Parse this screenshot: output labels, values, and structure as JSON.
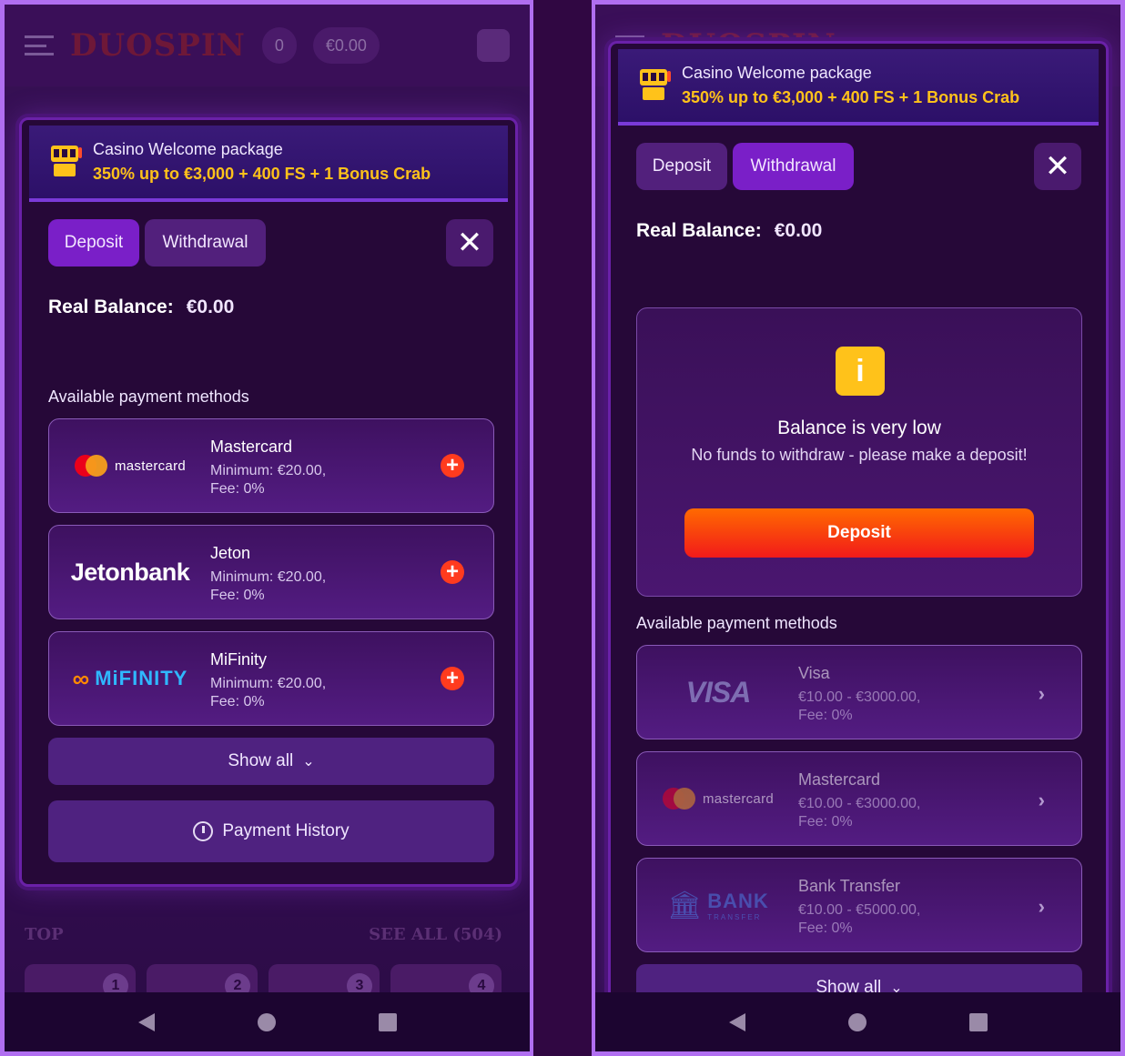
{
  "background_app": {
    "logo_text": "DUOSPIN",
    "coins": "0",
    "balance": "€0.00",
    "top_label": "TOP",
    "see_all": "SEE ALL (504)",
    "card_numbers": [
      "1",
      "2",
      "3",
      "4"
    ]
  },
  "promo": {
    "title": "Casino Welcome package",
    "offer": "350% up to €3,000 + 400 FS + 1 Bonus Crab"
  },
  "tabs": {
    "deposit": "Deposit",
    "withdrawal": "Withdrawal"
  },
  "balance": {
    "label": "Real Balance:",
    "value": "€0.00"
  },
  "left": {
    "active_tab": "deposit",
    "section_label": "Available payment methods",
    "methods": [
      {
        "name": "Mastercard",
        "logo": "mastercard",
        "min": "Minimum: €20.00,",
        "fee": "Fee: 0%"
      },
      {
        "name": "Jeton",
        "logo": "Jetonbank",
        "min": "Minimum: €20.00,",
        "fee": "Fee: 0%"
      },
      {
        "name": "MiFinity",
        "logo": "MiFINITY",
        "min": "Minimum: €20.00,",
        "fee": "Fee: 0%"
      }
    ],
    "show_all": "Show all",
    "payment_history": "Payment History"
  },
  "right": {
    "active_tab": "withdrawal",
    "alert": {
      "icon": "i",
      "title": "Balance is very low",
      "body": "No funds to withdraw - please make a deposit!",
      "button": "Deposit"
    },
    "section_label": "Available payment methods",
    "methods": [
      {
        "name": "Visa",
        "logo": "VISA",
        "range": "€10.00 - €3000.00,",
        "fee": "Fee: 0%"
      },
      {
        "name": "Mastercard",
        "logo": "mastercard",
        "range": "€10.00 - €3000.00,",
        "fee": "Fee: 0%"
      },
      {
        "name": "Bank Transfer",
        "logo_main": "BANK",
        "logo_sub": "TRANSFER",
        "range": "€10.00 - €5000.00,",
        "fee": "Fee: 0%"
      }
    ],
    "show_all": "Show all"
  },
  "colors": {
    "accent_purple": "#7a1fc8",
    "promo_yellow": "#ffc21a",
    "cta_orange": "#ff6a00",
    "cta_red": "#f21a1a"
  }
}
